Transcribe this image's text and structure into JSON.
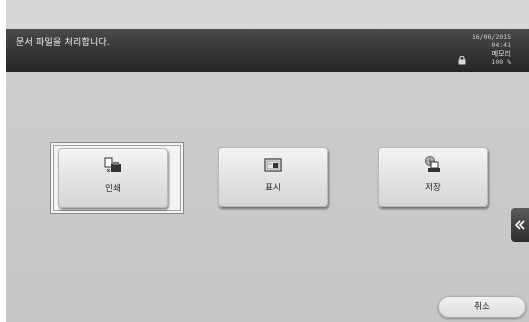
{
  "header": {
    "message": "문서 파일을 처리합니다.",
    "date": "16/06/2015",
    "time": "04:41",
    "memory_label": "메모리",
    "memory_percent": "100 %"
  },
  "functions": [
    {
      "label": "인쇄",
      "icon": "print-icon",
      "selected": true
    },
    {
      "label": "표시",
      "icon": "display-icon",
      "selected": false
    },
    {
      "label": "저장",
      "icon": "save-icon",
      "selected": false
    }
  ],
  "footer": {
    "cancel_label": "취소"
  },
  "colors": {
    "header_bg": "#2f2f2f",
    "panel_bg": "#c9c9c9",
    "button_bg": "#e6e6e6"
  }
}
